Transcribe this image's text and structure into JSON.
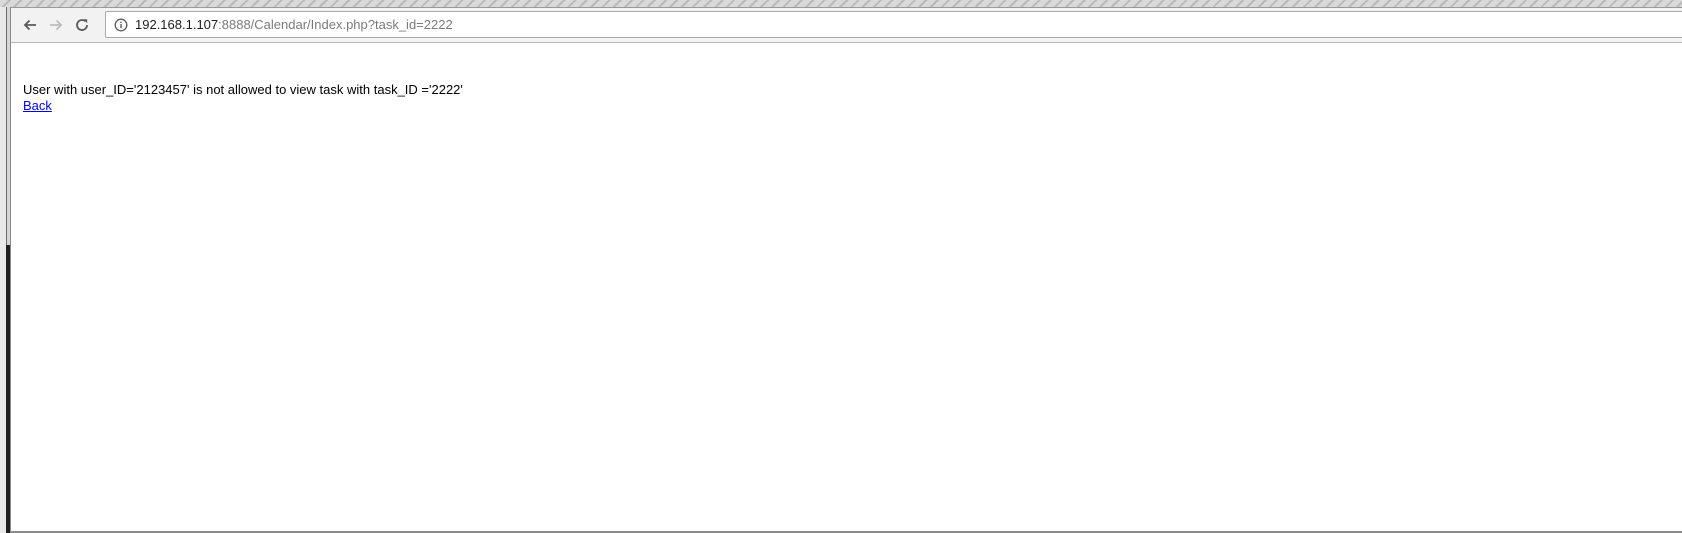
{
  "browser": {
    "address_bar": {
      "host": "192.168.1.107",
      "path": ":8888/Calendar/Index.php?task_id=2222"
    }
  },
  "page": {
    "message": "User with user_ID='2123457' is not allowed to view task with task_ID ='2222'",
    "back_link_label": "Back"
  },
  "colors": {
    "link": "#0000ee",
    "text": "#000000",
    "url_path": "#7a7a7a"
  },
  "icons": {
    "back": "arrow-left",
    "forward": "arrow-right",
    "reload": "reload",
    "site_info": "info-circle"
  }
}
